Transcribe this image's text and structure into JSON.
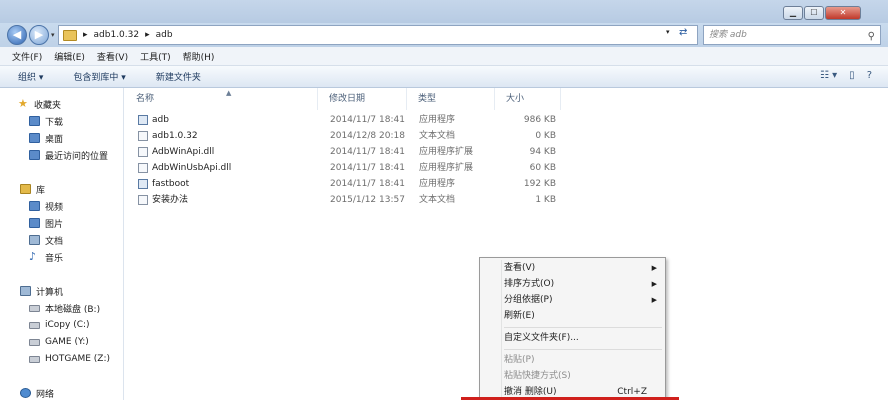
{
  "window": {
    "buttons": {
      "minimize": "▁",
      "maximize": "☐",
      "close": "✕"
    }
  },
  "address": {
    "breadcrumb": [
      "adb1.0.32",
      "adb"
    ],
    "separator": "▸"
  },
  "search": {
    "placeholder": "搜索 adb"
  },
  "menu": [
    "文件(F)",
    "编辑(E)",
    "查看(V)",
    "工具(T)",
    "帮助(H)"
  ],
  "toolbar": {
    "organize": "组织",
    "include_library": "包含到库中",
    "new_folder": "新建文件夹"
  },
  "sidebar": {
    "favorites": {
      "label": "收藏夹",
      "items": [
        "下载",
        "桌面",
        "最近访问的位置"
      ]
    },
    "libraries": {
      "label": "库",
      "items": [
        "视频",
        "图片",
        "文档",
        "音乐"
      ]
    },
    "computer": {
      "label": "计算机",
      "items": [
        "本地磁盘 (B:)",
        "iCopy (C:)",
        "GAME (Y:)",
        "HOTGAME (Z:)"
      ]
    },
    "network": {
      "label": "网络"
    }
  },
  "columns": {
    "name": "名称",
    "date": "修改日期",
    "type": "类型",
    "size": "大小"
  },
  "files": [
    {
      "name": "adb",
      "date": "2014/11/7 18:41",
      "type": "应用程序",
      "size": "986 KB",
      "icon": "exe"
    },
    {
      "name": "adb1.0.32",
      "date": "2014/12/8 20:18",
      "type": "文本文档",
      "size": "0 KB",
      "icon": "txt"
    },
    {
      "name": "AdbWinApi.dll",
      "date": "2014/11/7 18:41",
      "type": "应用程序扩展",
      "size": "94 KB",
      "icon": "dll"
    },
    {
      "name": "AdbWinUsbApi.dll",
      "date": "2014/11/7 18:41",
      "type": "应用程序扩展",
      "size": "60 KB",
      "icon": "dll"
    },
    {
      "name": "fastboot",
      "date": "2014/11/7 18:41",
      "type": "应用程序",
      "size": "192 KB",
      "icon": "exe"
    },
    {
      "name": "安装办法",
      "date": "2015/1/12 13:57",
      "type": "文本文档",
      "size": "1 KB",
      "icon": "txt"
    }
  ],
  "context_menu": {
    "view": "查看(V)",
    "sort": "排序方式(O)",
    "group": "分组依据(P)",
    "refresh": "刷新(E)",
    "customize": "自定义文件夹(F)...",
    "paste": "粘贴(P)",
    "paste_shortcut": "粘贴快捷方式(S)",
    "undo_delete": "撤消 删除(U)",
    "undo_shortcut": "Ctrl+Z"
  },
  "colors": {
    "titlebar": "#c5d6ea",
    "toolbar": "#dde7f3",
    "highlight": "#d0201c"
  }
}
